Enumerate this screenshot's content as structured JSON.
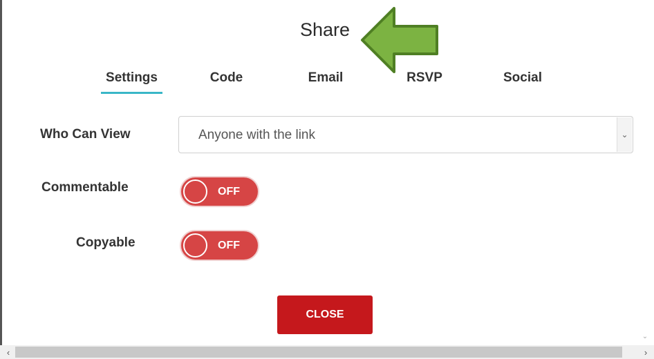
{
  "dialog": {
    "title": "Share"
  },
  "tabs": [
    {
      "label": "Settings",
      "active": true
    },
    {
      "label": "Code",
      "active": false
    },
    {
      "label": "Email",
      "active": false
    },
    {
      "label": "RSVP",
      "active": false
    },
    {
      "label": "Social",
      "active": false
    }
  ],
  "settings": {
    "who_can_view": {
      "label": "Who Can View",
      "value": "Anyone with the link"
    },
    "commentable": {
      "label": "Commentable",
      "state": "OFF"
    },
    "copyable": {
      "label": "Copyable",
      "state": "OFF"
    }
  },
  "buttons": {
    "close_label": "CLOSE"
  },
  "scrollbar": {
    "left_arrow": "‹",
    "right_arrow": "›",
    "down_arrow": "⌄"
  },
  "colors": {
    "tab_underline": "#39b6c7",
    "toggle_off": "#d64545",
    "close_button": "#c5181c",
    "annotation_arrow": "#7cb342"
  },
  "icons": {
    "annotation": "green-arrow-icon",
    "select_chevron": "chevron-down-icon"
  }
}
